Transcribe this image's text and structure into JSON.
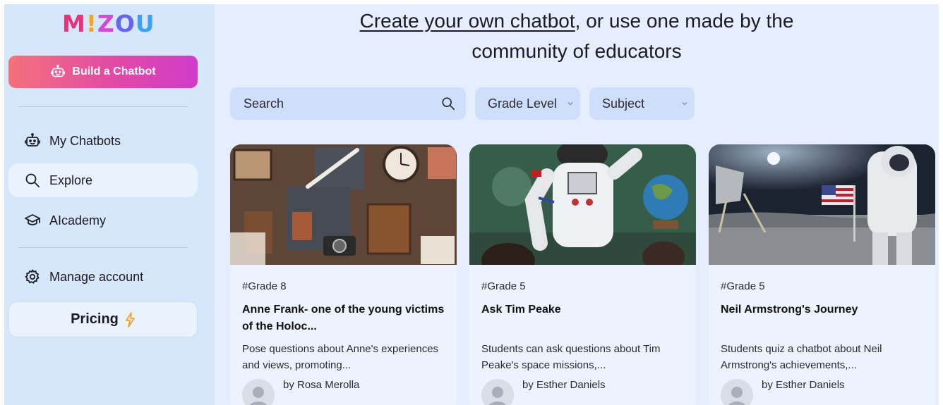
{
  "logo": {
    "letters": [
      "M",
      "!",
      "Z",
      "O",
      "U"
    ]
  },
  "sidebar": {
    "build_button": "Build a Chatbot",
    "nav": [
      {
        "label": "My Chatbots",
        "icon": "robot-icon"
      },
      {
        "label": "Explore",
        "icon": "search-icon"
      },
      {
        "label": "AIcademy",
        "icon": "graduation-cap-icon"
      },
      {
        "label": "Manage account",
        "icon": "gear-icon"
      }
    ],
    "pricing": "Pricing"
  },
  "header": {
    "link_text": "Create your own chatbot",
    "rest_text": ", or use one made by the community of educators"
  },
  "filters": {
    "search_placeholder": "Search",
    "grade_level": "Grade Level",
    "subject": "Subject"
  },
  "cards": [
    {
      "grade": "#Grade 8",
      "title": "Anne Frank- one of the  young victims of the Holoc...",
      "description": "Pose questions about Anne's experiences and views, promoting...",
      "author": "by Rosa Merolla"
    },
    {
      "grade": "#Grade 5",
      "title": "Ask Tim Peake",
      "description": "Students can ask questions about Tim Peake's space missions,...",
      "author": "by Esther Daniels"
    },
    {
      "grade": "#Grade 5",
      "title": "Neil Armstrong's Journey",
      "description": "Students quiz a chatbot about Neil Armstrong's achievements,...",
      "author": "by Esther Daniels"
    }
  ],
  "colors": {
    "accent_start": "#f4717c",
    "accent_end": "#d03bc9",
    "sidebar_bg": "#d6e6fb",
    "main_bg": "#e6edfd"
  }
}
